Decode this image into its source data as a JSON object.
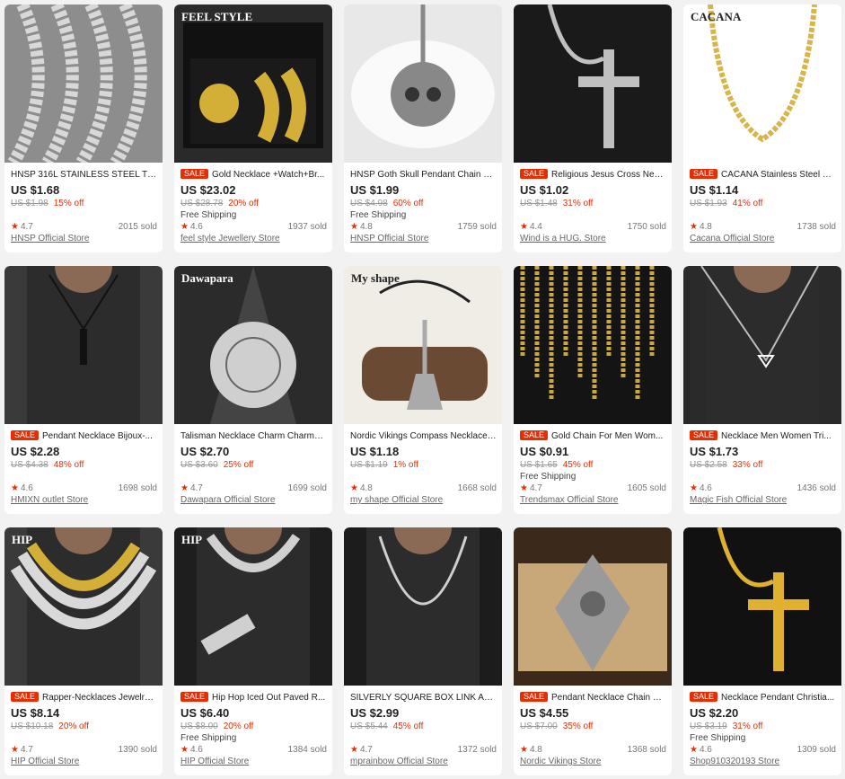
{
  "products": [
    {
      "title": "HNSP 316L STAINLESS STEEL TWIS...",
      "sale": "",
      "price": "US $1.68",
      "orig": "US $1.98",
      "discount": "15% off",
      "shipping": "",
      "rating": "4.7",
      "sold": "2015 sold",
      "store": "HNSP Official Store",
      "thumb": {
        "bg": "#8d8d8d",
        "fg": "#d8d8d8",
        "icon": "wheat-chain-bundle-photo",
        "overlay": ""
      }
    },
    {
      "title": "Gold Necklace +Watch+Br...",
      "sale": "SALE",
      "price": "US $23.02",
      "orig": "US $28.78",
      "discount": "20% off",
      "shipping": "Free Shipping",
      "rating": "4.6",
      "sold": "1937 sold",
      "store": "feel style Jewellery Store",
      "thumb": {
        "bg": "#2a2a2a",
        "fg": "#d4af37",
        "icon": "gold-watch-set-photo",
        "overlay": "FEEL STYLE"
      }
    },
    {
      "title": "HNSP Goth Skull Pendant Chain N...",
      "sale": "",
      "price": "US $1.99",
      "orig": "US $4.98",
      "discount": "60% off",
      "shipping": "Free Shipping",
      "rating": "4.8",
      "sold": "1759 sold",
      "store": "HNSP Official Store",
      "thumb": {
        "bg": "#e8e8e8",
        "fg": "#888888",
        "icon": "skull-pendant-photo",
        "overlay": ""
      }
    },
    {
      "title": "Religious Jesus Cross Neck...",
      "sale": "SALE",
      "price": "US $1.02",
      "orig": "US $1.48",
      "discount": "31% off",
      "shipping": "",
      "rating": "4.4",
      "sold": "1750 sold",
      "store": "Wind is a HUG. Store",
      "thumb": {
        "bg": "#1a1a1a",
        "fg": "#c0c0c0",
        "icon": "crucifix-pendant-photo",
        "overlay": ""
      }
    },
    {
      "title": "CACANA Stainless Steel C...",
      "sale": "SALE",
      "price": "US $1.14",
      "orig": "US $1.93",
      "discount": "41% off",
      "shipping": "",
      "rating": "4.8",
      "sold": "1738 sold",
      "store": "Cacana Official Store",
      "thumb": {
        "bg": "#ffffff",
        "fg": "#d9b44a",
        "icon": "gold-chain-photo",
        "overlay": "CACANA"
      }
    },
    {
      "title": "Pendant Necklace Bijoux-...",
      "sale": "SALE",
      "price": "US $2.28",
      "orig": "US $4.38",
      "discount": "48% off",
      "shipping": "",
      "rating": "4.6",
      "sold": "1698 sold",
      "store": "HMIXN outlet Store",
      "thumb": {
        "bg": "#3a3a3a",
        "fg": "#1a1a1a",
        "icon": "bar-pendant-photo",
        "overlay": ""
      }
    },
    {
      "title": "Talisman Necklace Charm Charms-...",
      "sale": "",
      "price": "US $2.70",
      "orig": "US $3.60",
      "discount": "25% off",
      "shipping": "",
      "rating": "4.7",
      "sold": "1699 sold",
      "store": "Dawapara Official Store",
      "thumb": {
        "bg": "#2b2b2b",
        "fg": "#cfcfcf",
        "icon": "talisman-disc-photo",
        "overlay": "Dawapara"
      }
    },
    {
      "title": "Nordic Vikings Compass Necklace ...",
      "sale": "",
      "price": "US $1.18",
      "orig": "US $1.19",
      "discount": "1% off",
      "shipping": "",
      "rating": "4.8",
      "sold": "1668 sold",
      "store": "my shape Official Store",
      "thumb": {
        "bg": "#f0ece6",
        "fg": "#6a4a32",
        "icon": "viking-axe-pendant-photo",
        "overlay": "My shape"
      }
    },
    {
      "title": "Gold Chain For Men Wom...",
      "sale": "SALE",
      "price": "US $0.91",
      "orig": "US $1.65",
      "discount": "45% off",
      "shipping": "Free Shipping",
      "rating": "4.7",
      "sold": "1605 sold",
      "store": "Trendsmax Official Store",
      "thumb": {
        "bg": "#141414",
        "fg": "#c9a646",
        "icon": "gold-chains-row-photo",
        "overlay": ""
      }
    },
    {
      "title": "Necklace Men Women Tri...",
      "sale": "SALE",
      "price": "US $1.73",
      "orig": "US $2.58",
      "discount": "33% off",
      "shipping": "",
      "rating": "4.6",
      "sold": "1436 sold",
      "store": "Magic Fish Official Store",
      "thumb": {
        "bg": "#2a2a2a",
        "fg": "#bbbbbb",
        "icon": "triangle-pendant-photo",
        "overlay": ""
      }
    },
    {
      "title": "Rapper-Necklaces Jewelry ...",
      "sale": "SALE",
      "price": "US $8.14",
      "orig": "US $10.18",
      "discount": "20% off",
      "shipping": "",
      "rating": "4.7",
      "sold": "1390 sold",
      "store": "HIP Official Store",
      "thumb": {
        "bg": "#3a3a3a",
        "fg": "#d9d9d9",
        "icon": "cuban-chains-photo",
        "overlay": "HIP"
      }
    },
    {
      "title": "Hip Hop Iced Out Paved R...",
      "sale": "SALE",
      "price": "US $6.40",
      "orig": "US $8.00",
      "discount": "20% off",
      "shipping": "Free Shipping",
      "rating": "4.6",
      "sold": "1384 sold",
      "store": "HIP Official Store",
      "thumb": {
        "bg": "#1e1e1e",
        "fg": "#d0d0d0",
        "icon": "iced-chain-bracelet-photo",
        "overlay": "HIP"
      }
    },
    {
      "title": "SILVERLY SQUARE BOX LINK AND I...",
      "sale": "",
      "price": "US $2.99",
      "orig": "US $5.44",
      "discount": "45% off",
      "shipping": "",
      "rating": "4.7",
      "sold": "1372 sold",
      "store": "mprainbow Official Store",
      "thumb": {
        "bg": "#1c1c1c",
        "fg": "#cfcfcf",
        "icon": "box-chain-photo",
        "overlay": ""
      }
    },
    {
      "title": "Pendant Necklace Chain H...",
      "sale": "SALE",
      "price": "US $4.55",
      "orig": "US $7.00",
      "discount": "35% off",
      "shipping": "",
      "rating": "4.8",
      "sold": "1368 sold",
      "store": "Nordic Vikings Store",
      "thumb": {
        "bg": "#3b2a1c",
        "fg": "#9a9a9a",
        "icon": "arrowhead-pendant-photo",
        "overlay": ""
      }
    },
    {
      "title": "Necklace Pendant Christia...",
      "sale": "SALE",
      "price": "US $2.20",
      "orig": "US $3.19",
      "discount": "31% off",
      "shipping": "Free Shipping",
      "rating": "4.6",
      "sold": "1309 sold",
      "store": "Shop910320193 Store",
      "thumb": {
        "bg": "#111111",
        "fg": "#e0b030",
        "icon": "gold-crucifix-photo",
        "overlay": ""
      }
    }
  ]
}
